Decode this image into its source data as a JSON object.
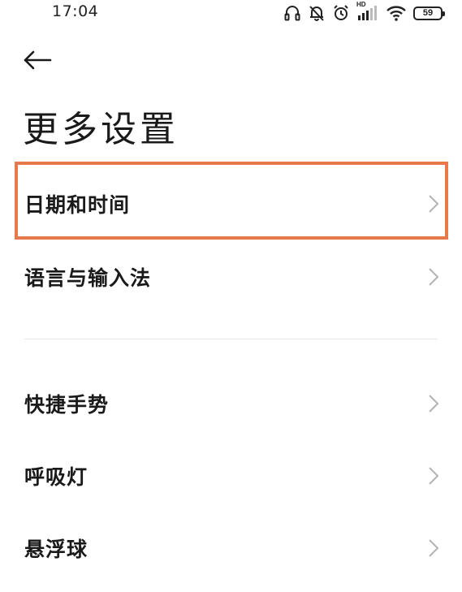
{
  "status_bar": {
    "time": "17:04",
    "network_label": "HD",
    "battery_level": "59",
    "icons": [
      "headphones-icon",
      "muted-bell-icon",
      "alarm-icon",
      "signal-icon",
      "wifi-icon",
      "battery-icon"
    ]
  },
  "header": {
    "back_icon": "back-arrow-icon",
    "title": "更多设置"
  },
  "list": {
    "group1": [
      {
        "label": "日期和时间",
        "highlighted": true
      },
      {
        "label": "语言与输入法",
        "highlighted": false
      }
    ],
    "group2": [
      {
        "label": "快捷手势"
      },
      {
        "label": "呼吸灯"
      },
      {
        "label": "悬浮球"
      }
    ]
  },
  "colors": {
    "highlight": "#e8794a",
    "chevron": "#b3b3b3",
    "text": "#1a1a1a"
  }
}
